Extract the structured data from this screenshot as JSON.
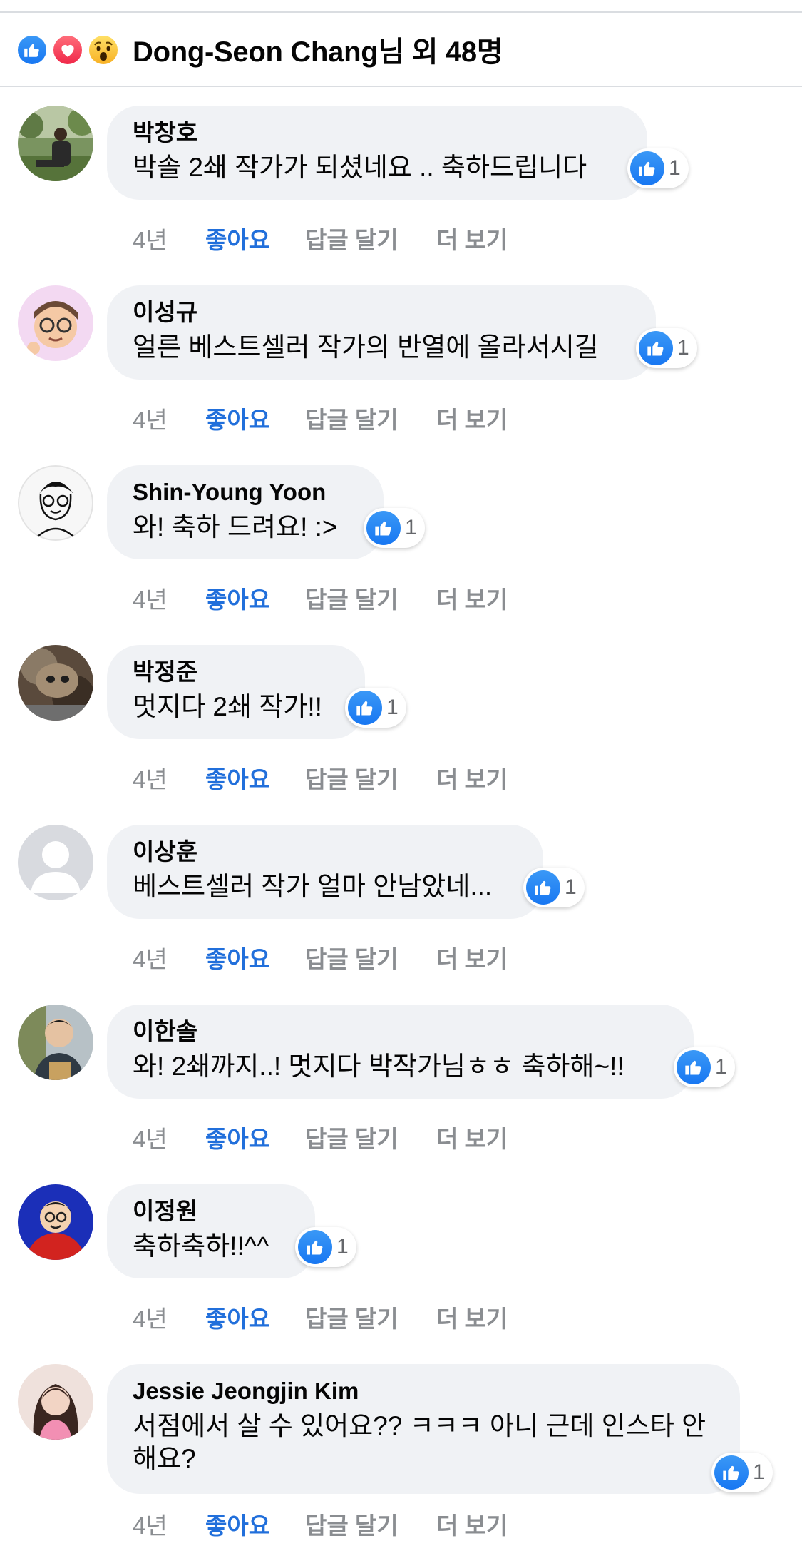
{
  "header": {
    "reaction_icons": [
      "like-icon",
      "love-icon",
      "wow-icon"
    ],
    "summary": "Dong-Seon Chang님 외 48명"
  },
  "actions": {
    "time": "4년",
    "like": "좋아요",
    "reply": "답글 달기",
    "more": "더 보기"
  },
  "comments": [
    {
      "author": "박창호",
      "text": "박솔 2쇄 작가가 되셨네요 .. 축하드립니다",
      "likes": "1",
      "avatar": "photo-park-avatar"
    },
    {
      "author": "이성규",
      "text": "얼른 베스트셀러 작가의 반열에 올라서시길",
      "likes": "1",
      "avatar": "cartoon-glasses-avatar"
    },
    {
      "author": "Shin-Young Yoon",
      "text": "와! 축하 드려요! :>",
      "likes": "1",
      "avatar": "sketch-face-avatar"
    },
    {
      "author": "박정준",
      "text": "멋지다 2쇄 작가!!",
      "likes": "1",
      "avatar": "photo-cat-avatar"
    },
    {
      "author": "이상훈",
      "text": "베스트셀러 작가 얼마 안남았네...",
      "likes": "1",
      "avatar": "default-person-avatar"
    },
    {
      "author": "이한솔",
      "text": "와! 2쇄까지..! 멋지다 박작가님ㅎㅎ 축하해~!!",
      "likes": "1",
      "avatar": "photo-selfie-avatar"
    },
    {
      "author": "이정원",
      "text": "축하축하!!^^",
      "likes": "1",
      "avatar": "cartoon-red-avatar"
    },
    {
      "author": "Jessie Jeongjin Kim",
      "text": "서점에서 살 수 있어요?? ㅋㅋㅋ 아니 근데 인스타 안해요?",
      "likes": "1",
      "avatar": "photo-woman-avatar"
    }
  ],
  "colors": {
    "link_blue": "#216fdb",
    "like_blue": "#1877f2",
    "bubble_bg": "#f0f2f5",
    "meta_gray": "#8a8d91"
  }
}
